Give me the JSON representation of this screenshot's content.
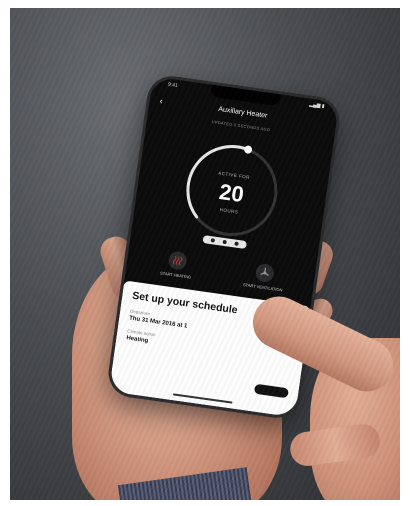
{
  "scene": {
    "description_icon": "photo-scene",
    "background_color": "#4a4d51"
  },
  "phone": {
    "status": {
      "time": "9:41",
      "indicators": "▂▄▆ ▮"
    },
    "app_title": "Auxiliary Heater",
    "subtitle": "UPDATED 9 SECONDS AGO",
    "dial": {
      "label": "ACTIVE FOR",
      "value": "20",
      "unit": "HOURS",
      "fill_fraction": 0.55
    },
    "actions": [
      {
        "label": "START HEATING",
        "icon": "heating-icon",
        "color": "#c0392b"
      },
      {
        "label": "START VENTILATION",
        "icon": "fan-icon",
        "color": "#9a9a9a"
      }
    ],
    "schedule_sheet": {
      "title": "Set up your schedule",
      "fields": [
        {
          "label": "Departure",
          "value": "Thu 31 Mar 2016 at 1"
        },
        {
          "label": "Climate action",
          "value": "Heating"
        }
      ]
    }
  }
}
